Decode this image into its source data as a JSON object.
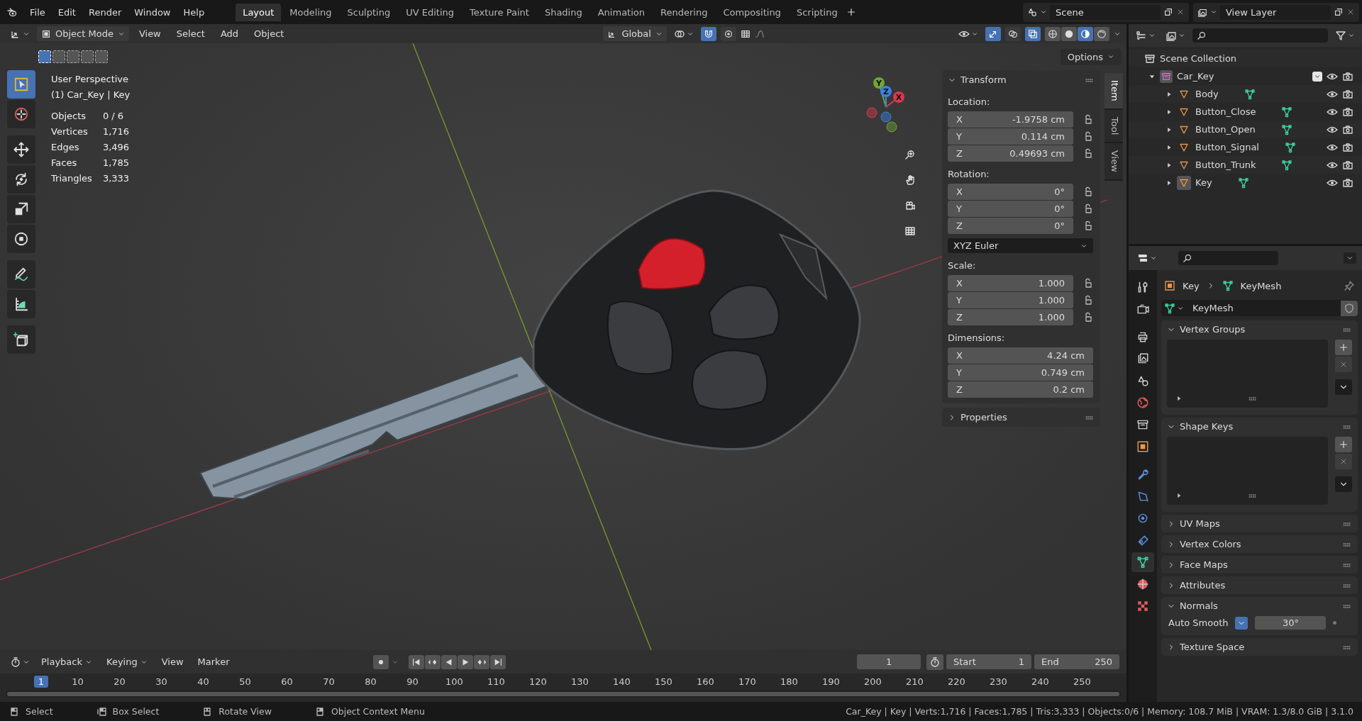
{
  "topbar": {
    "menus": [
      "File",
      "Edit",
      "Render",
      "Window",
      "Help"
    ],
    "workspaces": [
      {
        "label": "Layout",
        "selected": true
      },
      {
        "label": "Modeling",
        "selected": false
      },
      {
        "label": "Sculpting",
        "selected": false
      },
      {
        "label": "UV Editing",
        "selected": false
      },
      {
        "label": "Texture Paint",
        "selected": false
      },
      {
        "label": "Shading",
        "selected": false
      },
      {
        "label": "Animation",
        "selected": false
      },
      {
        "label": "Rendering",
        "selected": false
      },
      {
        "label": "Compositing",
        "selected": false
      },
      {
        "label": "Scripting",
        "selected": false
      }
    ],
    "scene": "Scene",
    "view_layer": "View Layer"
  },
  "header": {
    "mode": "Object Mode",
    "menus": [
      "View",
      "Select",
      "Add",
      "Object"
    ],
    "orientation": "Global",
    "toggles": [
      {
        "kind": "snap",
        "on": true
      },
      {
        "kind": "proportional",
        "on": false
      }
    ],
    "view_toggles": [
      {
        "kind": "gizmo",
        "on": true
      },
      {
        "kind": "overlay",
        "on": false
      },
      {
        "kind": "xray",
        "on": true
      }
    ],
    "shading": [
      {
        "selected": false
      },
      {
        "selected": false
      },
      {
        "selected": true
      },
      {
        "selected": false
      }
    ],
    "options": "Options"
  },
  "viewport": {
    "select_modes": [
      {
        "selected": true
      },
      {
        "selected": false
      },
      {
        "selected": false
      },
      {
        "selected": false
      },
      {
        "selected": false
      }
    ],
    "tools": [
      {
        "kind": "select",
        "selected": true
      },
      {
        "kind": "cursor",
        "selected": false
      },
      {
        "kind": "move",
        "selected": false
      },
      {
        "kind": "rotate",
        "selected": false
      },
      {
        "kind": "scale",
        "selected": false
      },
      {
        "kind": "transform",
        "selected": false
      },
      {
        "kind": "annotate",
        "selected": false
      },
      {
        "kind": "measure",
        "selected": false
      },
      {
        "kind": "add-cube",
        "selected": false
      }
    ],
    "title": "User Perspective",
    "object": "(1) Car_Key | Key",
    "stats": [
      {
        "label": "Objects",
        "value": "0 / 6"
      },
      {
        "label": "Vertices",
        "value": "1,716"
      },
      {
        "label": "Edges",
        "value": "3,496"
      },
      {
        "label": "Faces",
        "value": "1,785"
      },
      {
        "label": "Triangles",
        "value": "3,333"
      }
    ],
    "gizmo": [
      {
        "label": "X",
        "color": "#d8394f"
      },
      {
        "label": "Y",
        "color": "#6ea535"
      },
      {
        "label": "Z",
        "color": "#3a82e0"
      }
    ]
  },
  "sidebar": {
    "tabs": [
      {
        "label": "Item",
        "selected": true
      },
      {
        "label": "Tool",
        "selected": false
      },
      {
        "label": "View",
        "selected": false
      }
    ],
    "transform": {
      "title": "Transform",
      "expanded": true,
      "groups": [
        {
          "label": "Location:",
          "locks": true,
          "rows": [
            {
              "axis": "X",
              "value": "-1.9758 cm"
            },
            {
              "axis": "Y",
              "value": "0.114 cm"
            },
            {
              "axis": "Z",
              "value": "0.49693 cm"
            }
          ]
        },
        {
          "label": "Rotation:",
          "locks": true,
          "rows": [
            {
              "axis": "X",
              "value": "0°"
            },
            {
              "axis": "Y",
              "value": "0°"
            },
            {
              "axis": "Z",
              "value": "0°"
            }
          ],
          "mode": "XYZ Euler"
        },
        {
          "label": "Scale:",
          "locks": true,
          "rows": [
            {
              "axis": "X",
              "value": "1.000"
            },
            {
              "axis": "Y",
              "value": "1.000"
            },
            {
              "axis": "Z",
              "value": "1.000"
            }
          ]
        },
        {
          "label": "Dimensions:",
          "locks": false,
          "rows": [
            {
              "axis": "X",
              "value": "4.24 cm"
            },
            {
              "axis": "Y",
              "value": "0.749 cm"
            },
            {
              "axis": "Z",
              "value": "0.2 cm"
            }
          ]
        }
      ]
    },
    "properties": {
      "title": "Properties",
      "expanded": false
    }
  },
  "outliner": {
    "root": "Scene Collection",
    "items": [
      {
        "label": "Car_Key",
        "kind": "collection",
        "checked": true,
        "expanded": true,
        "children": [
          {
            "label": "Body",
            "kind": "mesh",
            "active": false,
            "expanded": false
          },
          {
            "label": "Button_Close",
            "kind": "mesh",
            "active": false,
            "expanded": false
          },
          {
            "label": "Button_Open",
            "kind": "mesh",
            "active": false,
            "expanded": false
          },
          {
            "label": "Button_Signal",
            "kind": "mesh",
            "active": false,
            "expanded": false
          },
          {
            "label": "Button_Trunk",
            "kind": "mesh",
            "active": false,
            "expanded": false
          },
          {
            "label": "Key",
            "kind": "mesh",
            "active": true,
            "expanded": false
          }
        ]
      }
    ]
  },
  "properties": {
    "tabs": [
      {
        "kind": "tool",
        "selected": false
      },
      {
        "kind": "render",
        "selected": false
      },
      {
        "kind": "output",
        "selected": false
      },
      {
        "kind": "view-layer",
        "selected": false
      },
      {
        "kind": "scene",
        "selected": false
      },
      {
        "kind": "world",
        "selected": false
      },
      {
        "kind": "collection",
        "selected": false
      },
      {
        "kind": "object",
        "selected": false
      },
      {
        "kind": "modifiers",
        "selected": false
      },
      {
        "kind": "particles",
        "selected": false
      },
      {
        "kind": "physics",
        "selected": false
      },
      {
        "kind": "constraints",
        "selected": false
      },
      {
        "kind": "data",
        "selected": true
      },
      {
        "kind": "material",
        "selected": false
      },
      {
        "kind": "texture",
        "selected": false
      }
    ],
    "breadcrumb": [
      "Key",
      "KeyMesh"
    ],
    "mesh": "KeyMesh",
    "panels": [
      {
        "title": "Vertex Groups",
        "expanded": true,
        "kind": "list"
      },
      {
        "title": "Shape Keys",
        "expanded": true,
        "kind": "list"
      },
      {
        "title": "UV Maps",
        "expanded": false,
        "kind": "plain"
      },
      {
        "title": "Vertex Colors",
        "expanded": false,
        "kind": "plain"
      },
      {
        "title": "Face Maps",
        "expanded": false,
        "kind": "plain"
      },
      {
        "title": "Attributes",
        "expanded": false,
        "kind": "plain"
      },
      {
        "title": "Normals",
        "expanded": true,
        "kind": "normals",
        "label": "Auto Smooth",
        "checked": true,
        "value": "30°"
      },
      {
        "title": "Texture Space",
        "expanded": false,
        "kind": "plain"
      }
    ]
  },
  "timeline": {
    "menus": [
      "Playback",
      "Keying",
      "View",
      "Marker"
    ],
    "current": "1",
    "start_label": "Start",
    "start": "1",
    "end_label": "End",
    "end": "250",
    "frames": [
      {
        "label": "1",
        "selected": true
      },
      {
        "label": "10",
        "selected": false
      },
      {
        "label": "20",
        "selected": false
      },
      {
        "label": "30",
        "selected": false
      },
      {
        "label": "40",
        "selected": false
      },
      {
        "label": "50",
        "selected": false
      },
      {
        "label": "60",
        "selected": false
      },
      {
        "label": "70",
        "selected": false
      },
      {
        "label": "80",
        "selected": false
      },
      {
        "label": "90",
        "selected": false
      },
      {
        "label": "100",
        "selected": false
      },
      {
        "label": "110",
        "selected": false
      },
      {
        "label": "120",
        "selected": false
      },
      {
        "label": "130",
        "selected": false
      },
      {
        "label": "140",
        "selected": false
      },
      {
        "label": "150",
        "selected": false
      },
      {
        "label": "160",
        "selected": false
      },
      {
        "label": "170",
        "selected": false
      },
      {
        "label": "180",
        "selected": false
      },
      {
        "label": "190",
        "selected": false
      },
      {
        "label": "200",
        "selected": false
      },
      {
        "label": "210",
        "selected": false
      },
      {
        "label": "220",
        "selected": false
      },
      {
        "label": "230",
        "selected": false
      },
      {
        "label": "240",
        "selected": false
      },
      {
        "label": "250",
        "selected": false
      }
    ]
  },
  "status": {
    "hints": [
      {
        "kind": "lmb",
        "label": "Select"
      },
      {
        "kind": "lmb-drag",
        "label": "Box Select"
      },
      {
        "kind": "mmb",
        "label": "Rotate View"
      },
      {
        "kind": "rmb",
        "label": "Object Context Menu"
      }
    ],
    "info": "Car_Key | Key | Verts:1,716 | Faces:1,785 | Tris:3,333 | Objects:0/6 | Memory: 108.7 MiB | VRAM: 1.3/8.0 GiB | 3.1.0"
  }
}
